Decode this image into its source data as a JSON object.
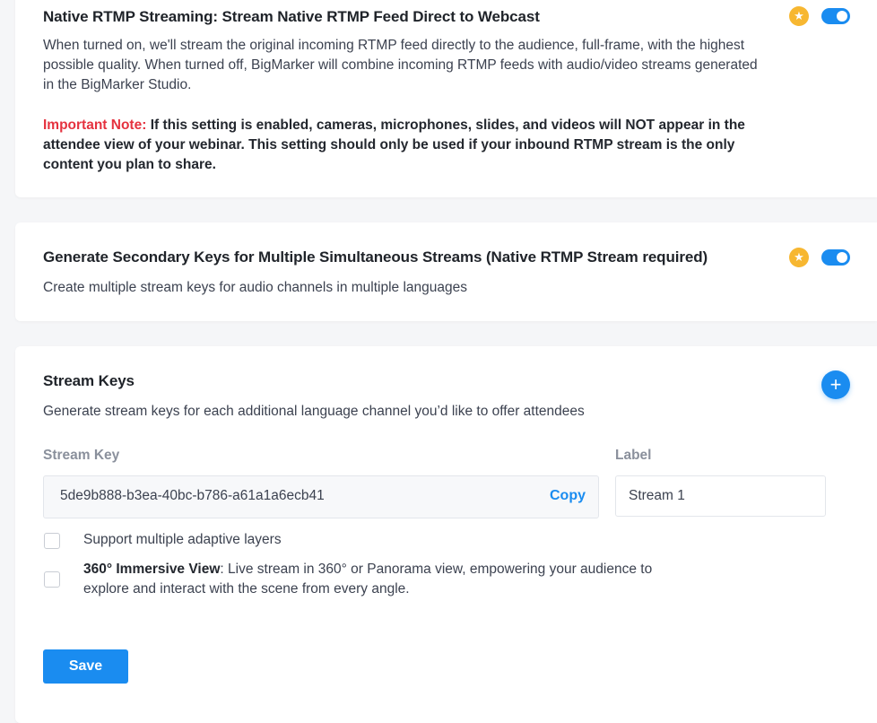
{
  "native_rtmp": {
    "title": "Native RTMP Streaming: Stream Native RTMP Feed Direct to Webcast",
    "description": "When turned on, we'll stream the original incoming RTMP feed directly to the audience, full-frame, with the highest possible quality. When turned off, BigMarker will combine incoming RTMP feeds with audio/video streams generated in the BigMarker Studio.",
    "note_label": "Important Note:",
    "note_text": " If this setting is enabled, cameras, microphones, slides, and videos will NOT appear in the attendee view of your webinar. This setting should only be used if your inbound RTMP stream is the only content you plan to share.",
    "enabled": true
  },
  "secondary_keys": {
    "title": "Generate Secondary Keys for Multiple Simultaneous Streams (Native RTMP Stream required)",
    "description": "Create multiple stream keys for audio channels in multiple languages",
    "enabled": true
  },
  "stream_keys": {
    "title": "Stream Keys",
    "description": "Generate stream keys for each additional language channel you’d like to offer attendees",
    "add_icon": "plus-icon",
    "stream_key_label": "Stream Key",
    "label_label": "Label",
    "key_value": "5de9b888-b3ea-40bc-b786-a61a1a6ecb41",
    "copy_label": "Copy",
    "label_value": "Stream 1",
    "adaptive_layers_label": "Support multiple adaptive layers",
    "immersive_bold": "360° Immersive View",
    "immersive_text": ": Live stream in 360° or Panorama view, empowering your audience to explore and interact with the scene from every angle.",
    "save_label": "Save"
  },
  "colors": {
    "accent": "#1a8cf0",
    "star": "#f7b731",
    "note_red": "#e5323f"
  }
}
